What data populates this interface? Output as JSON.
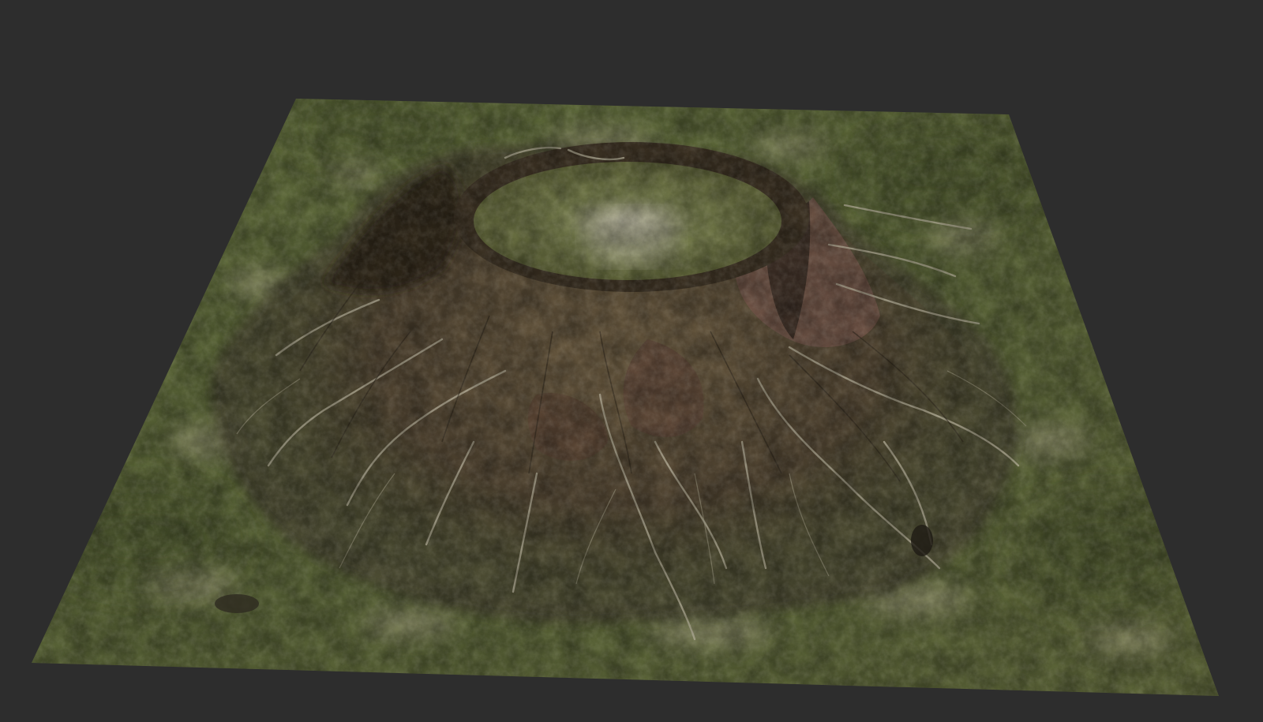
{
  "scene": {
    "background_color": "#2d2d2d",
    "subject": "terrain-render",
    "colors": {
      "grass": "#5a6437",
      "grass_dark": "#434b2a",
      "grass_light": "#6e7646",
      "rock": "#5b4a36",
      "rock_dark": "#2e261c",
      "rock_light": "#8a7556",
      "rock_reddish": "#7a5a4a",
      "sediment": "#b9b39c",
      "crater_floor": "#6b7244"
    }
  }
}
